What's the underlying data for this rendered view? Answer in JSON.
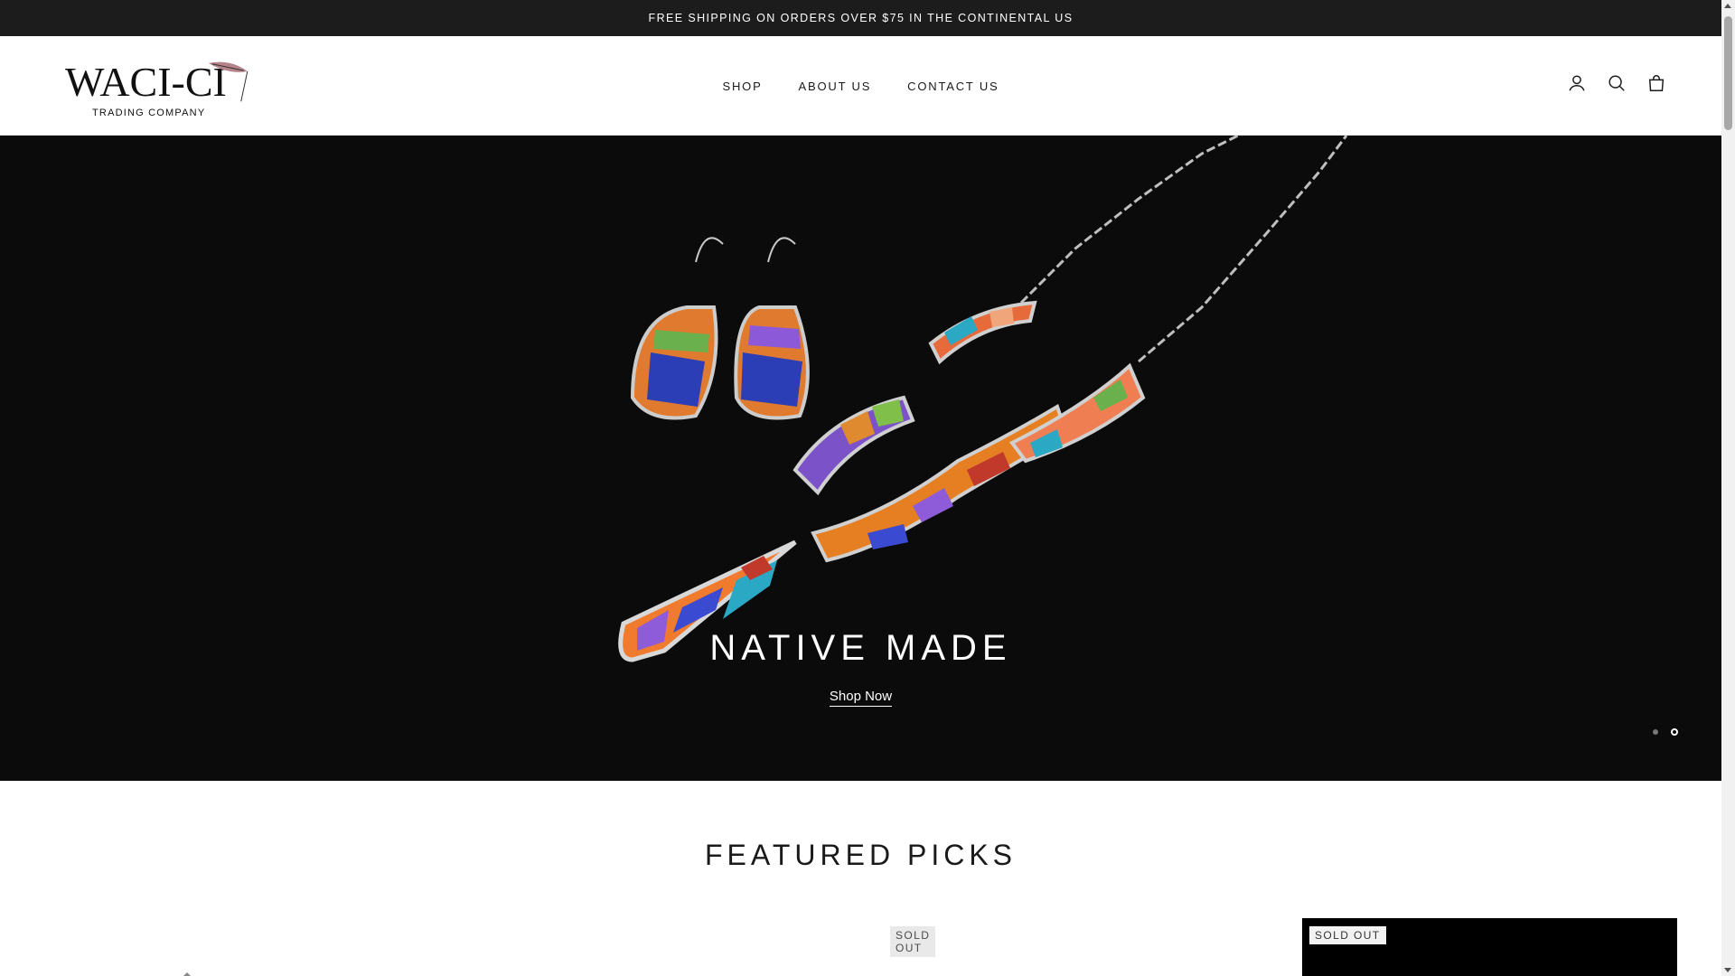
{
  "announcement": {
    "text": "FREE SHIPPING ON ORDERS OVER $75 IN THE CONTINENTAL US"
  },
  "header": {
    "logo": {
      "text": "WACI-CI",
      "tagline": "TRADING COMPANY"
    },
    "nav": [
      {
        "label": "SHOP"
      },
      {
        "label": "ABOUT US"
      },
      {
        "label": "CONTACT US"
      }
    ],
    "icons": [
      "account-icon",
      "search-icon",
      "cart-icon"
    ]
  },
  "hero": {
    "title": "NATIVE MADE",
    "cta": "Shop Now",
    "slides_total": 2,
    "active_slide": 2
  },
  "featured": {
    "title": "FEATURED PICKS",
    "products": [
      {
        "badge": ""
      },
      {
        "badge": "SOLD OUT"
      },
      {
        "badge": ""
      },
      {
        "badge": "SOLD OUT"
      }
    ]
  }
}
